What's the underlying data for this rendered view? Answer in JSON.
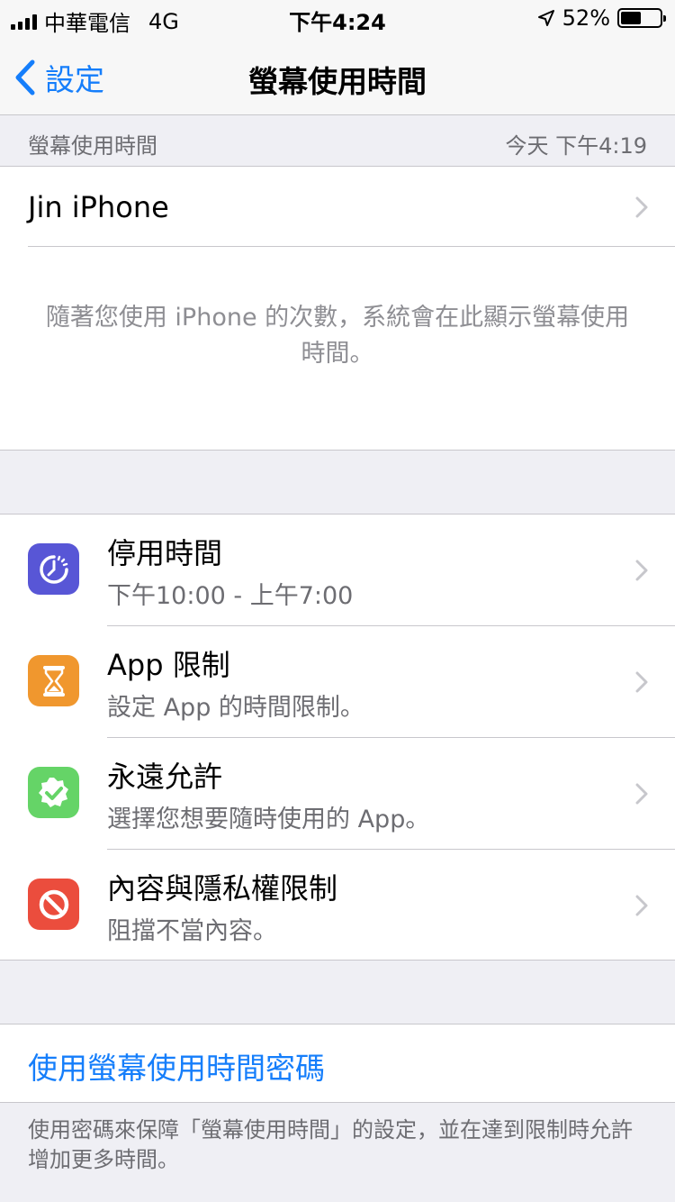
{
  "status_bar": {
    "carrier": "中華電信",
    "network": "4G",
    "time": "下午4:24",
    "battery_percent": "52%",
    "battery_level": 0.52
  },
  "nav": {
    "back_label": "設定",
    "title": "螢幕使用時間"
  },
  "summary_header": {
    "label": "螢幕使用時間",
    "updated": "今天 下午4:19"
  },
  "device": {
    "name": "Jin iPhone",
    "usage_note": "隨著您使用 iPhone 的次數，系統會在此顯示螢幕使用時間。"
  },
  "features": [
    {
      "title": "停用時間",
      "subtitle": "下午10:00 - 上午7:00",
      "icon": "downtime-icon",
      "color": "#5856d6"
    },
    {
      "title": "App 限制",
      "subtitle": "設定 App 的時間限制。",
      "icon": "hourglass-icon",
      "color": "#f0972e"
    },
    {
      "title": "永遠允許",
      "subtitle": "選擇您想要隨時使用的 App。",
      "icon": "checkmark-badge-icon",
      "color": "#65d467"
    },
    {
      "title": "內容與隱私權限制",
      "subtitle": "阻擋不當內容。",
      "icon": "restriction-icon",
      "color": "#eb4d3d"
    }
  ],
  "passcode": {
    "label": "使用螢幕使用時間密碼",
    "footer": "使用密碼來保障「螢幕使用時間」的設定，並在達到限制時允許增加更多時間。"
  },
  "colors": {
    "accent": "#157efb",
    "background": "#efeff4",
    "separator": "#c8c7cc",
    "secondary_text": "#6d6d72"
  }
}
